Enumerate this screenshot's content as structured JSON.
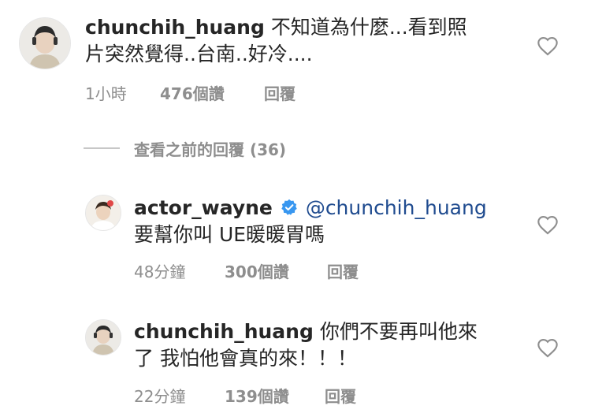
{
  "comments": [
    {
      "username": "chunchih_huang",
      "line1": "不知道為什麼...看到照",
      "line2": "片突然覺得..台南..好冷....",
      "time": "1小時",
      "likes": "476個讚",
      "reply": "回覆"
    }
  ],
  "view_previous": "查看之前的回覆 (36)",
  "replies": [
    {
      "username": "actor_wayne",
      "mention": "@chunchih_huang",
      "line1": "要幫你叫 UE暖暖胃嗎",
      "time": "48分鐘",
      "likes": "300個讚",
      "reply": "回覆"
    },
    {
      "username": "chunchih_huang",
      "line1": "你們不要再叫他來",
      "line2": "了 我怕他會真的來！！！",
      "time": "22分鐘",
      "likes": "139個讚",
      "reply": "回覆"
    }
  ],
  "colors": {
    "text": "#262626",
    "meta": "#8e8e8e",
    "mention": "#1f4b8f",
    "verified": "#3897f0"
  },
  "icons": {
    "like": "heart-outline-icon",
    "verified": "verified-badge-icon"
  }
}
